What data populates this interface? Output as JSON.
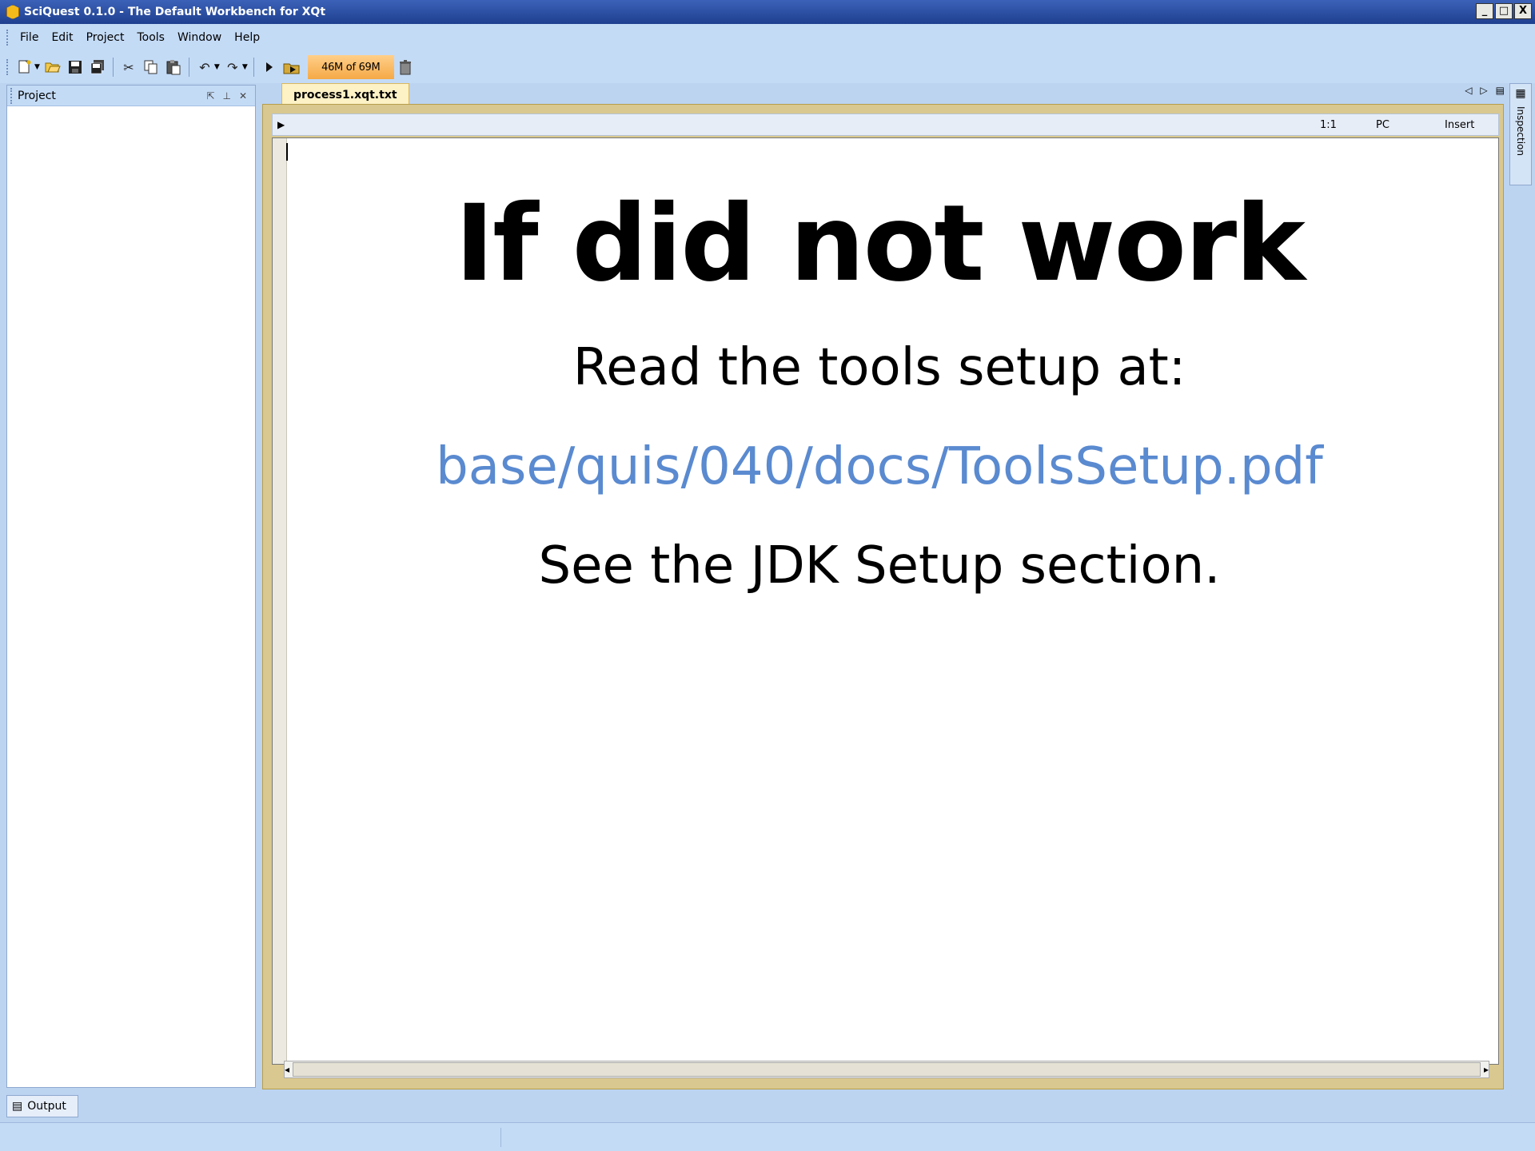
{
  "window": {
    "title": "SciQuest 0.1.0 - The Default Workbench for XQt",
    "controls": [
      "_",
      "□",
      "X"
    ]
  },
  "menu": [
    "File",
    "Edit",
    "Project",
    "Tools",
    "Window",
    "Help"
  ],
  "toolbar": {
    "icons": [
      "new-icon",
      "open-icon",
      "save-icon",
      "save-all-icon",
      "cut-icon",
      "copy-icon",
      "paste-icon",
      "undo-icon",
      "redo-icon",
      "run-icon",
      "run-project-icon",
      "trash-icon"
    ],
    "memory": "46M of 69M"
  },
  "project_panel": {
    "title": "Project"
  },
  "editor": {
    "tab": "process1.xqt.txt",
    "status": {
      "position": "1:1",
      "mode": "PC",
      "insert": "Insert"
    }
  },
  "side_panel": {
    "label": "Inspection"
  },
  "output_tab": {
    "label": "Output"
  },
  "slide": {
    "headline": "If did not work",
    "line1": "Read the tools setup at:",
    "link": "base/quis/040/docs/ToolsSetup.pdf",
    "line3": "See the JDK Setup section."
  },
  "colors": {
    "title_bar": "#1f3f8f",
    "chrome": "#c4dbf6",
    "link": "#5a8ad0",
    "memory_bar": "#f5a945",
    "tab": "#fdf1c6"
  }
}
